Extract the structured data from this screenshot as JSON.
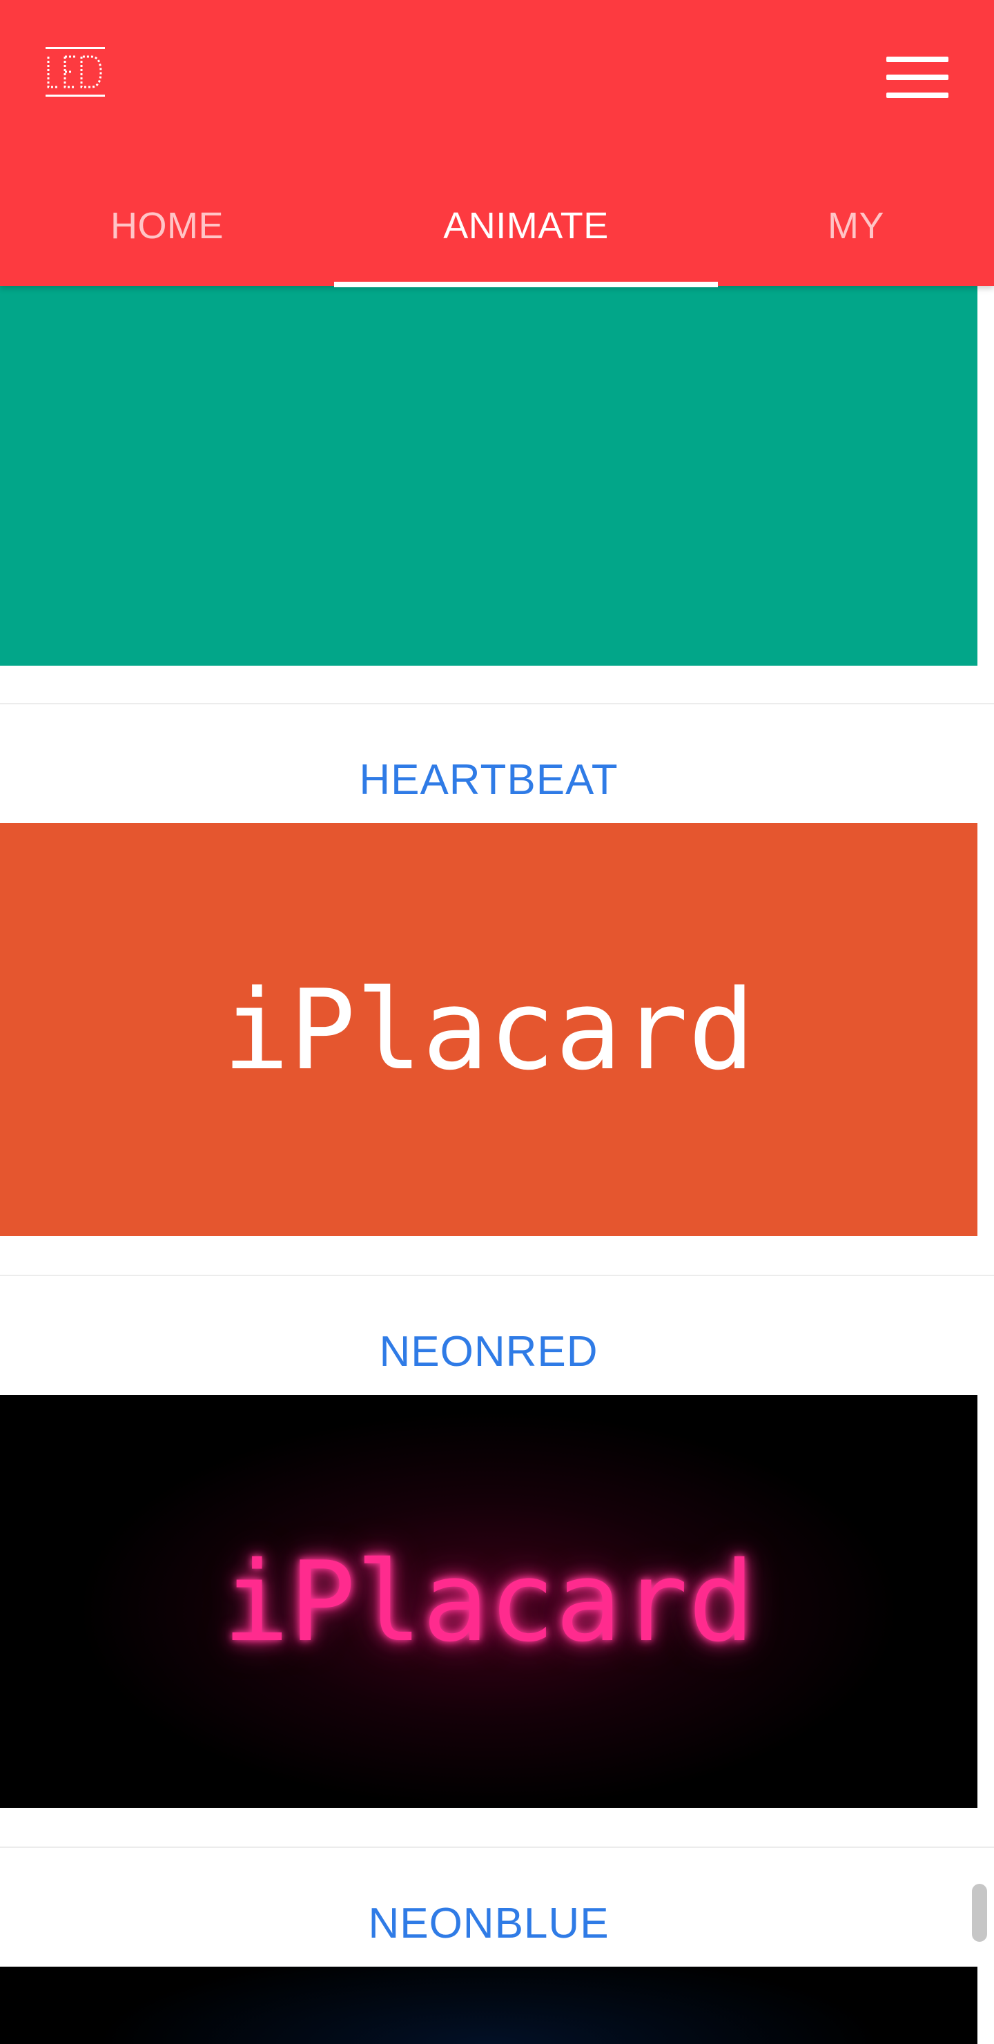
{
  "header": {
    "logo_icon": "led-logo-icon",
    "menu_icon": "hamburger-menu-icon",
    "background": "#fd3a40"
  },
  "tabs": [
    {
      "label": "HOME",
      "active": false
    },
    {
      "label": "ANIMATE",
      "active": true
    },
    {
      "label": "MY",
      "active": false
    }
  ],
  "cards": [
    {
      "title": "",
      "preview_color": "#02a689",
      "preview_text": ""
    },
    {
      "title": "HEARTBEAT",
      "preview_color": "#e5562f",
      "preview_text": "iPlacard"
    },
    {
      "title": "NEONRED",
      "preview_color": "#000000",
      "preview_text": "iPlacard",
      "text_color": "#ff2b8e"
    },
    {
      "title": "NEONBLUE",
      "preview_color": "#000000",
      "preview_text": ""
    }
  ],
  "colors": {
    "accent_title": "#2f7be6"
  }
}
